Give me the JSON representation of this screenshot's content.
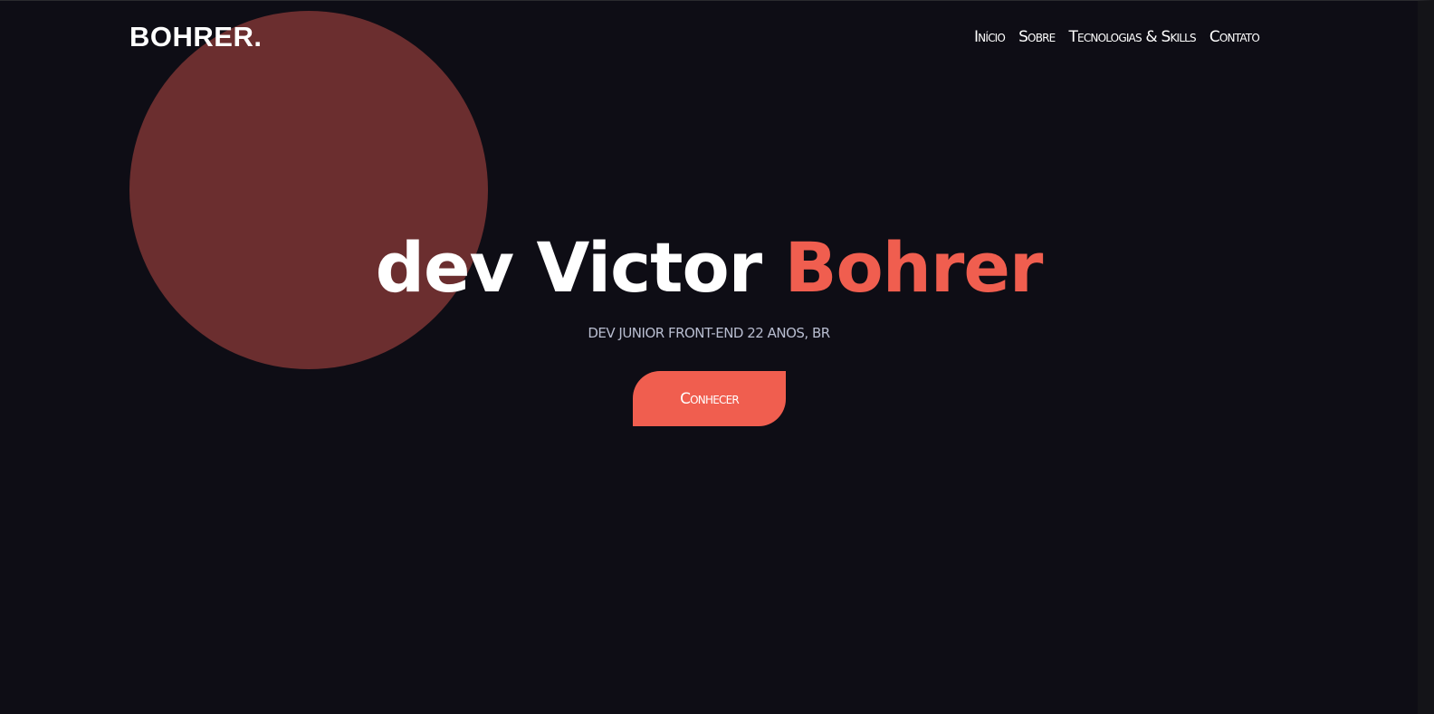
{
  "brand": {
    "logo": "BOHRER."
  },
  "nav": {
    "items": [
      {
        "label": "Início"
      },
      {
        "label": "Sobre"
      },
      {
        "label": "Tecnologias & Skills"
      },
      {
        "label": "Contato"
      }
    ]
  },
  "hero": {
    "title_main": "dev Victor ",
    "title_accent": "Bohrer",
    "subtitle": "DEV JUNIOR FRONT-END 22 ANOS, BR",
    "cta_label": "Conhecer"
  },
  "colors": {
    "background": "#0e0d15",
    "accent": "#f05e4f",
    "circle": "#6b2e2f",
    "subtitle": "#b8bdd0"
  }
}
